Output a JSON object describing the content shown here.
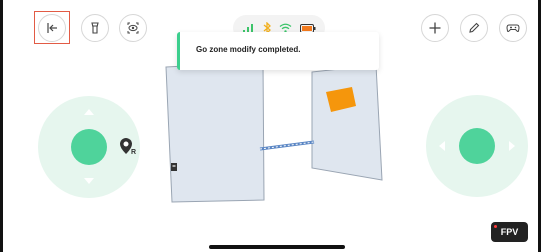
{
  "toolbar_left": {
    "exit_icon": "exit-icon",
    "flashlight_icon": "flashlight-icon",
    "camera_icon": "camera-view-icon"
  },
  "status": {
    "signal_icon": "signal-bars-icon",
    "bluetooth_icon": "bluetooth-icon",
    "wifi_icon": "wifi-icon",
    "battery_icon": "battery-icon",
    "colors": {
      "signal": "#3cc46a",
      "bluetooth": "#f2b01e",
      "wifi": "#3cc46a",
      "battery": "#f27a1e"
    }
  },
  "toolbar_right": {
    "add_icon": "plus-icon",
    "edit_icon": "pencil-icon",
    "gamepad_icon": "gamepad-icon"
  },
  "toast": {
    "message": "Go zone modify completed."
  },
  "map": {
    "room_fill": "#dfe6ef",
    "go_zone_color": "#f5960c",
    "path_color": "#5a86c4",
    "robot_marker_icon": "robot-location-icon",
    "dock_icon": "charging-dock-icon"
  },
  "joystick_left": {
    "colors": {
      "ring": "#e6f6ee",
      "knob": "#4fd39b"
    }
  },
  "joystick_right": {
    "colors": {
      "ring": "#e6f6ee",
      "knob": "#4fd39b"
    }
  },
  "fpv": {
    "label": "FPV"
  }
}
